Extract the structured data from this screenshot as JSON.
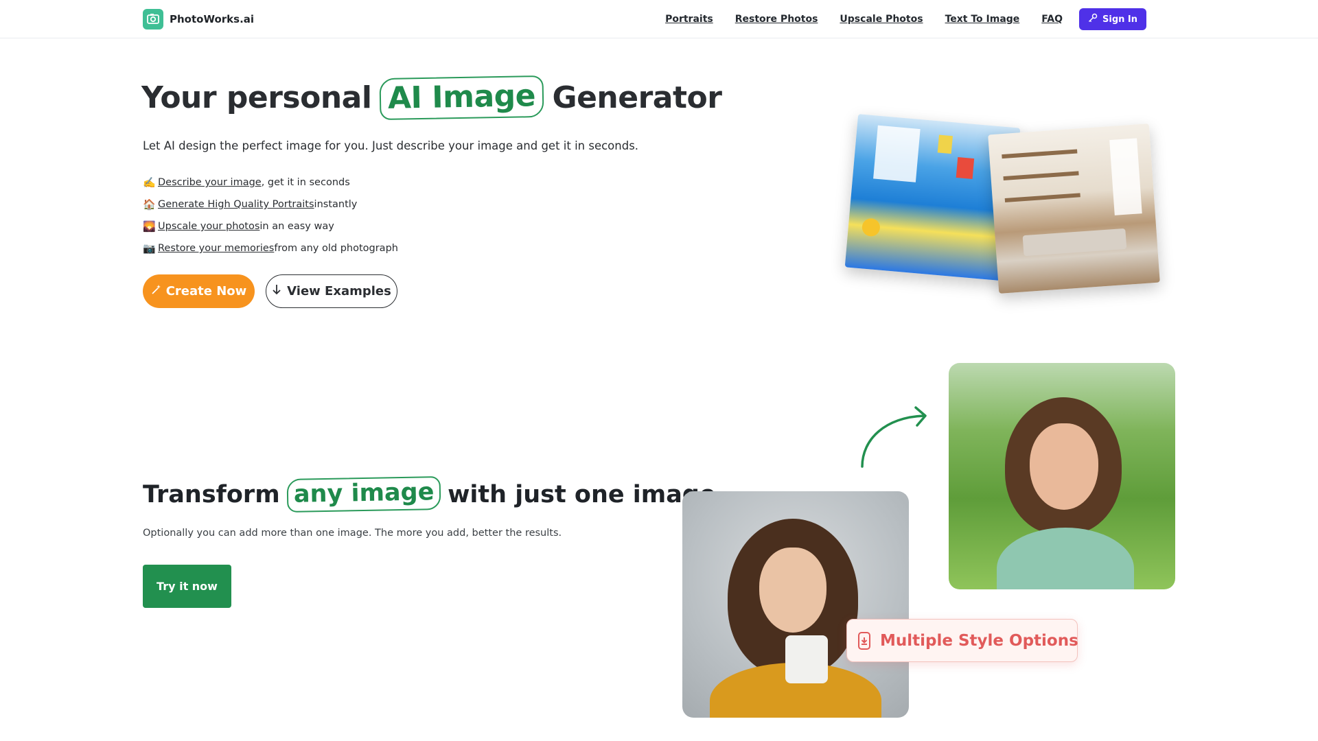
{
  "header": {
    "brand": "PhotoWorks.ai",
    "nav": [
      "Portraits",
      "Restore Photos",
      "Upscale Photos",
      "Text To Image",
      "FAQ"
    ],
    "signin_label": "Sign In"
  },
  "hero": {
    "title_before": "Your personal",
    "title_highlight": "AI Image",
    "title_after": "Generator",
    "subtitle": "Let AI design the perfect image for you. Just describe your image and get it in seconds.",
    "features": [
      {
        "emoji": "✍️",
        "link": "Describe your image",
        "rest": ", get it in seconds"
      },
      {
        "emoji": "🏠",
        "link": "Generate High Quality Portraits",
        "rest": " instantly"
      },
      {
        "emoji": "🌄",
        "link": "Upscale your photos",
        "rest": " in an easy way"
      },
      {
        "emoji": "📷",
        "link": "Restore your memories",
        "rest": " from any old photograph"
      }
    ],
    "create_label": "Create Now",
    "examples_label": "View Examples"
  },
  "transform": {
    "title_before": "Transform",
    "title_highlight": "any image",
    "title_after": "with just one image.",
    "subtitle": "Optionally you can add more than one image. The more you add, better the results.",
    "try_label": "Try it now",
    "badge_label": "Multiple Style Options"
  },
  "colors": {
    "brand_green": "#22904f",
    "accent_orange": "#f7931e",
    "signin_purple": "#4f31e8",
    "badge_red": "#e15a5a"
  }
}
